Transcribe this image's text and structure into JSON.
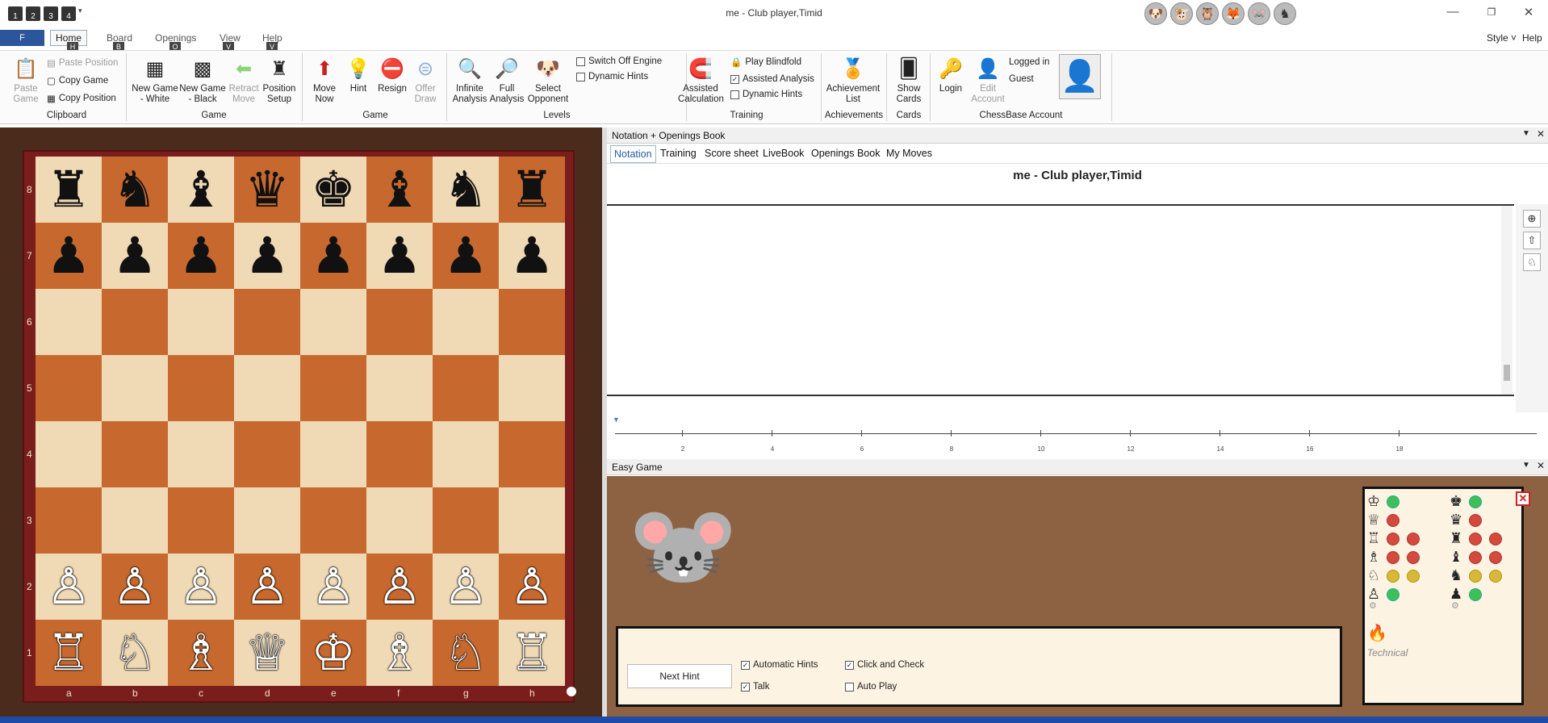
{
  "window": {
    "title": "me - Club player,Timid",
    "quick_access": [
      "1",
      "2",
      "3",
      "4"
    ],
    "style_label": "Style",
    "help_label": "Help"
  },
  "ribbon_tabs": {
    "file": "F",
    "tabs": [
      {
        "label": "Home",
        "key": "H",
        "active": true
      },
      {
        "label": "Board",
        "key": "B"
      },
      {
        "label": "Openings",
        "key": "O"
      },
      {
        "label": "View",
        "key": "V"
      },
      {
        "label": "Help",
        "key": "V"
      }
    ]
  },
  "ribbon": {
    "clipboard": {
      "paste_game": "Paste Game",
      "paste_position": "Paste Position",
      "copy_game": "Copy Game",
      "copy_position": "Copy Position",
      "group": "Clipboard"
    },
    "game": {
      "new_white": "New Game - White",
      "new_black": "New Game - Black",
      "retract": "Retract Move",
      "setup": "Position Setup",
      "group": "Game"
    },
    "game2": {
      "move_now": "Move Now",
      "hint": "Hint",
      "resign": "Resign",
      "offer_draw": "Offer Draw",
      "group": "Game"
    },
    "levels": {
      "infinite": "Infinite Analysis",
      "full": "Full Analysis",
      "select_opp": "Select Opponent",
      "switch_off": "Switch Off Engine",
      "dynamic": "Dynamic Hints",
      "group": "Levels"
    },
    "training": {
      "assisted_calc": "Assisted Calculation",
      "blindfold": "Play Blindfold",
      "assisted_analysis": "Assisted Analysis",
      "dynamic": "Dynamic Hints",
      "group": "Training"
    },
    "achievements": {
      "list": "Achievement List",
      "group": "Achievements"
    },
    "cards": {
      "show": "Show Cards",
      "group": "Cards"
    },
    "account": {
      "login": "Login",
      "edit": "Edit Account",
      "logged_in": "Logged in",
      "user": "Guest",
      "group": "ChessBase Account"
    }
  },
  "board": {
    "files": [
      "a",
      "b",
      "c",
      "d",
      "e",
      "f",
      "g",
      "h"
    ],
    "ranks": [
      "8",
      "7",
      "6",
      "5",
      "4",
      "3",
      "2",
      "1"
    ],
    "position": [
      [
        "♜",
        "♞",
        "♝",
        "♛",
        "♚",
        "♝",
        "♞",
        "♜"
      ],
      [
        "♟",
        "♟",
        "♟",
        "♟",
        "♟",
        "♟",
        "♟",
        "♟"
      ],
      [
        "",
        "",
        "",
        "",
        "",
        "",
        "",
        ""
      ],
      [
        "",
        "",
        "",
        "",
        "",
        "",
        "",
        ""
      ],
      [
        "",
        "",
        "",
        "",
        "",
        "",
        "",
        ""
      ],
      [
        "",
        "",
        "",
        "",
        "",
        "",
        "",
        ""
      ],
      [
        "♙",
        "♙",
        "♙",
        "♙",
        "♙",
        "♙",
        "♙",
        "♙"
      ],
      [
        "♖",
        "♘",
        "♗",
        "♕",
        "♔",
        "♗",
        "♘",
        "♖"
      ]
    ],
    "light_color": "#f0d9b5",
    "dark_color": "#c7692e"
  },
  "notation": {
    "header": "Notation + Openings Book",
    "tabs": [
      "Notation",
      "Training",
      "Score sheet",
      "LiveBook",
      "Openings Book",
      "My Moves"
    ],
    "game_title": "me - Club player,Timid",
    "timeline_ticks": [
      "2",
      "4",
      "6",
      "8",
      "10",
      "12",
      "14",
      "16",
      "18"
    ]
  },
  "easy_game": {
    "header": "Easy Game",
    "next_hint": "Next Hint",
    "automatic_hints": "Automatic Hints",
    "click_check": "Click and Check",
    "talk": "Talk",
    "auto_play": "Auto Play",
    "technical": "Technical",
    "white_rows": [
      {
        "piece": "♔",
        "dots": [
          "g"
        ]
      },
      {
        "piece": "♕",
        "dots": [
          "r"
        ]
      },
      {
        "piece": "♖",
        "dots": [
          "r",
          "r"
        ]
      },
      {
        "piece": "♗",
        "dots": [
          "r",
          "r"
        ]
      },
      {
        "piece": "♘",
        "dots": [
          "y",
          "y"
        ]
      },
      {
        "piece": "♙",
        "dots": [
          "g"
        ]
      }
    ],
    "black_rows": [
      {
        "piece": "♚",
        "dots": [
          "g"
        ]
      },
      {
        "piece": "♛",
        "dots": [
          "r"
        ]
      },
      {
        "piece": "♜",
        "dots": [
          "r",
          "r"
        ]
      },
      {
        "piece": "♝",
        "dots": [
          "r",
          "r"
        ]
      },
      {
        "piece": "♞",
        "dots": [
          "y",
          "y"
        ]
      },
      {
        "piece": "♟",
        "dots": [
          "g"
        ]
      }
    ]
  }
}
